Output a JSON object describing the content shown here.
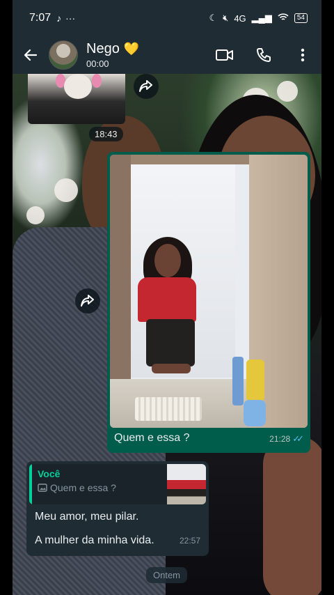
{
  "status_bar": {
    "time": "7:07",
    "left_icons": [
      "tiktok-icon",
      "more-dots-icon"
    ],
    "network": "4G",
    "battery": "54"
  },
  "header": {
    "contact_name": "Nego",
    "name_emoji": "💛",
    "subtitle": "00:00",
    "actions": [
      "video-call-icon",
      "voice-call-icon",
      "more-vert-icon"
    ]
  },
  "messages": {
    "top_media_time": "18:43",
    "image_message": {
      "caption": "Quem e essa ?",
      "time": "21:28",
      "status": "read"
    },
    "reply_message": {
      "quoted_author": "Você",
      "quoted_text": "Quem e essa ?",
      "line1": "Meu amor, meu pilar.",
      "line2": "A mulher da minha vida.",
      "time": "22:57"
    },
    "date_separator": "Ontem"
  },
  "colors": {
    "header_bg": "#1f2c34",
    "outgoing_bubble": "#005c4b",
    "incoming_bubble": "#1f2c34",
    "quote_accent": "#06cf9c",
    "read_ticks": "#53bdeb",
    "heart": "#f7c948"
  }
}
